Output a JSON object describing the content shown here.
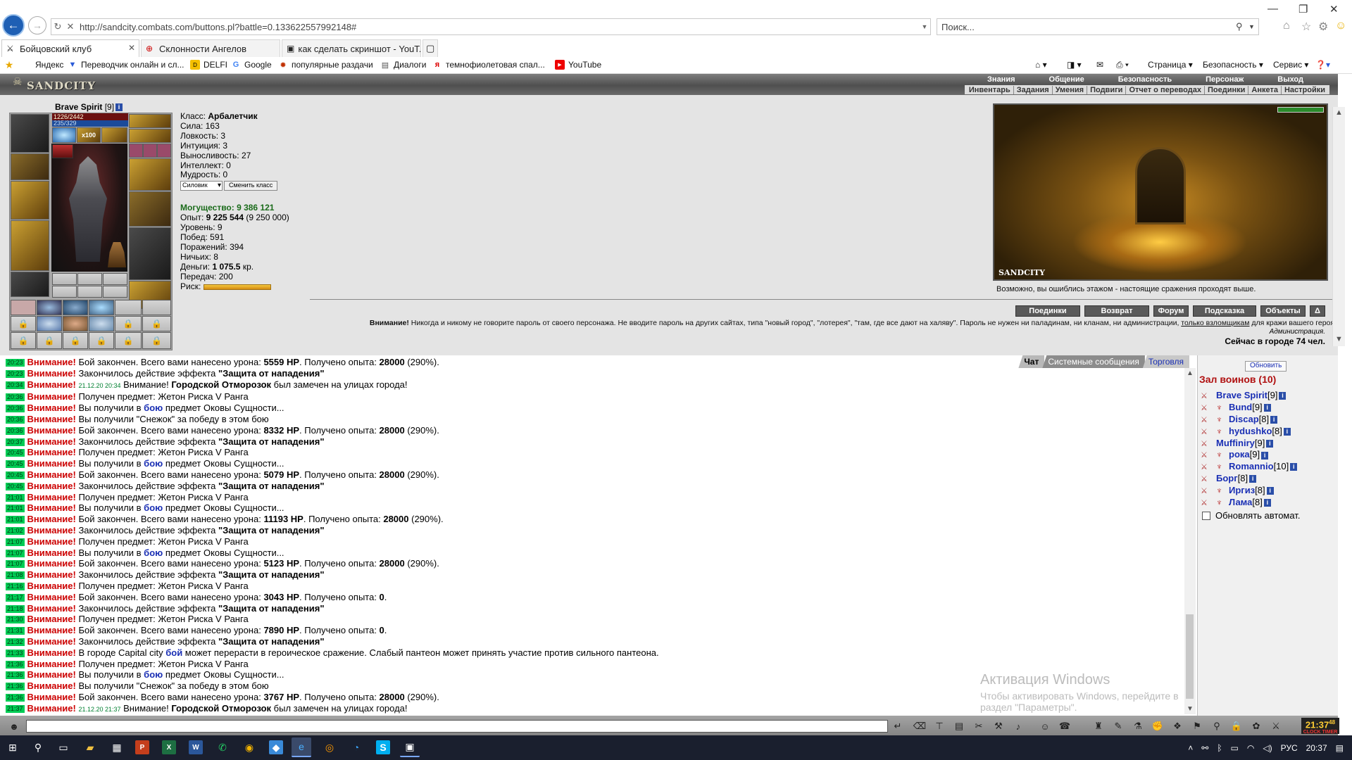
{
  "browser": {
    "url": "http://sandcity.combats.com/buttons.pl?battle=0.133622557992148#",
    "search_placeholder": "Поиск...",
    "tabs": [
      {
        "label": "Бойцовский клуб",
        "active": true
      },
      {
        "label": "Склонности Ангелов",
        "active": false
      },
      {
        "label": "как сделать скриншот - YouT...",
        "active": false
      }
    ],
    "favorites": [
      "Яндекс",
      "Переводчик онлайн и сл...",
      "DELFI",
      "Google",
      "популярные раздачи",
      "Диалоги",
      "темнофиолетовая спал...",
      "YouTube"
    ],
    "commands": {
      "page": "Страница",
      "safety": "Безопасность",
      "service": "Сервис"
    }
  },
  "game": {
    "logo": "SANDCITY",
    "menu_top": [
      "Знания",
      "Общение",
      "Безопасность",
      "Персонаж",
      "Выход"
    ],
    "menu_sub": [
      "Инвентарь",
      "Задания",
      "Умения",
      "Подвиги",
      "Отчет о переводах",
      "Поединки",
      "Анкета",
      "Настройки"
    ]
  },
  "character": {
    "name": "Brave Spirit",
    "level": "[9]",
    "hp": "1226/2442",
    "mp": "235/329",
    "rune_count": "x100",
    "class_label": "Класс:",
    "class_value": "Арбалетчик",
    "stats": [
      {
        "label": "Сила:",
        "value": "163"
      },
      {
        "label": "Ловкость:",
        "value": "3"
      },
      {
        "label": "Интуиция:",
        "value": "3"
      },
      {
        "label": "Выносливость:",
        "value": "27"
      },
      {
        "label": "Интеллект:",
        "value": "0"
      },
      {
        "label": "Мудрость:",
        "value": "0"
      }
    ],
    "class_select": "Силовик",
    "change_class_btn": "Сменить класс",
    "power_label": "Могущество:",
    "power_value": "9 386 121",
    "exp_label": "Опыт:",
    "exp_value": "9 225 544",
    "exp_next": "(9 250 000)",
    "level_label": "Уровень:",
    "level_value": "9",
    "wins_label": "Побед:",
    "wins_value": "591",
    "losses_label": "Поражений:",
    "losses_value": "394",
    "draws_label": "Ничьих:",
    "draws_value": "8",
    "money_label": "Деньги:",
    "money_value": "1 075.5",
    "money_unit": "кр.",
    "transfers_label": "Передач:",
    "transfers_value": "200",
    "risk_label": "Риск:",
    "risk_fraction": 1.0
  },
  "location": {
    "caption": "SANDCITY",
    "note": "Возможно, вы ошиблись этажом - настоящие сражения проходят выше.",
    "buttons": [
      "Поединки",
      "Возврат",
      "Форум",
      "Подсказка",
      "Объекты",
      "Δ"
    ]
  },
  "warning": {
    "bold": "Внимание!",
    "text": " Никогда и никому не говорите пароль от своего персонажа. Не вводите пароль на других сайтах, типа \"новый город\", \"лотерея\", \"там, где все дают на халяву\". Пароль не нужен ни паладинам, ни кланам, ни администрации, ",
    "link": "только взломщикам",
    "tail": " для кражи вашего героя.",
    "sign": "Администрация.",
    "online": "Сейчас в городе 74 чел."
  },
  "chat": {
    "tabs": [
      "Чат",
      "Системные сообщения",
      "Торговля"
    ],
    "messages": [
      {
        "time": "20:23",
        "parts": [
          [
            "n",
            "Бой закончен. Всего вами нанесено урона: "
          ],
          [
            "b",
            "5559 HP"
          ],
          [
            "n",
            ". Получено опыта: "
          ],
          [
            "b",
            "28000"
          ],
          [
            "n",
            " (290%)."
          ]
        ]
      },
      {
        "time": "20:23",
        "parts": [
          [
            "n",
            "Закончилось действие эффекта "
          ],
          [
            "b",
            "\"Защита от нападения\""
          ]
        ]
      },
      {
        "time": "20:34",
        "parts": [
          [
            "d",
            "21.12.20 20:34"
          ],
          [
            "n",
            " Внимание! "
          ],
          [
            "b",
            "Городской Отморозок"
          ],
          [
            "n",
            " был замечен на улицах города!"
          ]
        ]
      },
      {
        "time": "20:36",
        "parts": [
          [
            "n",
            "Получен предмет: Жетон Риска V Ранга"
          ]
        ]
      },
      {
        "time": "20:36",
        "parts": [
          [
            "n",
            "Вы получили в "
          ],
          [
            "l",
            "бою"
          ],
          [
            "n",
            " предмет Оковы Сущности..."
          ]
        ]
      },
      {
        "time": "20:36",
        "parts": [
          [
            "n",
            "Вы получили \"Снежок\" за победу в этом бою"
          ]
        ]
      },
      {
        "time": "20:36",
        "parts": [
          [
            "n",
            "Бой закончен. Всего вами нанесено урона: "
          ],
          [
            "b",
            "8332 HP"
          ],
          [
            "n",
            ". Получено опыта: "
          ],
          [
            "b",
            "28000"
          ],
          [
            "n",
            " (290%)."
          ]
        ]
      },
      {
        "time": "20:37",
        "parts": [
          [
            "n",
            "Закончилось действие эффекта "
          ],
          [
            "b",
            "\"Защита от нападения\""
          ]
        ]
      },
      {
        "time": "20:45",
        "parts": [
          [
            "n",
            "Получен предмет: Жетон Риска V Ранга"
          ]
        ]
      },
      {
        "time": "20:45",
        "parts": [
          [
            "n",
            "Вы получили в "
          ],
          [
            "l",
            "бою"
          ],
          [
            "n",
            " предмет Оковы Сущности..."
          ]
        ]
      },
      {
        "time": "20:45",
        "parts": [
          [
            "n",
            "Бой закончен. Всего вами нанесено урона: "
          ],
          [
            "b",
            "5079 HP"
          ],
          [
            "n",
            ". Получено опыта: "
          ],
          [
            "b",
            "28000"
          ],
          [
            "n",
            " (290%)."
          ]
        ]
      },
      {
        "time": "20:45",
        "parts": [
          [
            "n",
            "Закончилось действие эффекта "
          ],
          [
            "b",
            "\"Защита от нападения\""
          ]
        ]
      },
      {
        "time": "21:01",
        "parts": [
          [
            "n",
            "Получен предмет: Жетон Риска V Ранга"
          ]
        ]
      },
      {
        "time": "21:01",
        "parts": [
          [
            "n",
            "Вы получили в "
          ],
          [
            "l",
            "бою"
          ],
          [
            "n",
            " предмет Оковы Сущности..."
          ]
        ]
      },
      {
        "time": "21:01",
        "parts": [
          [
            "n",
            "Бой закончен. Всего вами нанесено урона: "
          ],
          [
            "b",
            "11193 HP"
          ],
          [
            "n",
            ". Получено опыта: "
          ],
          [
            "b",
            "28000"
          ],
          [
            "n",
            " (290%)."
          ]
        ]
      },
      {
        "time": "21:02",
        "parts": [
          [
            "n",
            "Закончилось действие эффекта "
          ],
          [
            "b",
            "\"Защита от нападения\""
          ]
        ]
      },
      {
        "time": "21:07",
        "parts": [
          [
            "n",
            "Получен предмет: Жетон Риска V Ранга"
          ]
        ]
      },
      {
        "time": "21:07",
        "parts": [
          [
            "n",
            "Вы получили в "
          ],
          [
            "l",
            "бою"
          ],
          [
            "n",
            " предмет Оковы Сущности..."
          ]
        ]
      },
      {
        "time": "21:07",
        "parts": [
          [
            "n",
            "Бой закончен. Всего вами нанесено урона: "
          ],
          [
            "b",
            "5123 HP"
          ],
          [
            "n",
            ". Получено опыта: "
          ],
          [
            "b",
            "28000"
          ],
          [
            "n",
            " (290%)."
          ]
        ]
      },
      {
        "time": "21:08",
        "parts": [
          [
            "n",
            "Закончилось действие эффекта "
          ],
          [
            "b",
            "\"Защита от нападения\""
          ]
        ]
      },
      {
        "time": "21:16",
        "parts": [
          [
            "n",
            "Получен предмет: Жетон Риска V Ранга"
          ]
        ]
      },
      {
        "time": "21:17",
        "parts": [
          [
            "n",
            "Бой закончен. Всего вами нанесено урона: "
          ],
          [
            "b",
            "3043 HP"
          ],
          [
            "n",
            ". Получено опыта: "
          ],
          [
            "b",
            "0"
          ],
          [
            "n",
            "."
          ]
        ]
      },
      {
        "time": "21:18",
        "parts": [
          [
            "n",
            "Закончилось действие эффекта "
          ],
          [
            "b",
            "\"Защита от нападения\""
          ]
        ]
      },
      {
        "time": "21:30",
        "parts": [
          [
            "n",
            "Получен предмет: Жетон Риска V Ранга"
          ]
        ]
      },
      {
        "time": "21:31",
        "parts": [
          [
            "n",
            "Бой закончен. Всего вами нанесено урона: "
          ],
          [
            "b",
            "7890 HP"
          ],
          [
            "n",
            ". Получено опыта: "
          ],
          [
            "b",
            "0"
          ],
          [
            "n",
            "."
          ]
        ]
      },
      {
        "time": "21:32",
        "parts": [
          [
            "n",
            "Закончилось действие эффекта "
          ],
          [
            "b",
            "\"Защита от нападения\""
          ]
        ]
      },
      {
        "time": "21:33",
        "parts": [
          [
            "n",
            "В городе Capital city "
          ],
          [
            "l",
            "бой"
          ],
          [
            "n",
            " может перерасти в героическое сражение. Слабый пантеон может принять участие против сильного пантеона."
          ]
        ]
      },
      {
        "time": "21:36",
        "parts": [
          [
            "n",
            "Получен предмет: Жетон Риска V Ранга"
          ]
        ]
      },
      {
        "time": "21:36",
        "parts": [
          [
            "n",
            "Вы получили в "
          ],
          [
            "l",
            "бою"
          ],
          [
            "n",
            " предмет Оковы Сущности..."
          ]
        ]
      },
      {
        "time": "21:36",
        "parts": [
          [
            "n",
            "Вы получили \"Снежок\" за победу в этом бою"
          ]
        ]
      },
      {
        "time": "21:36",
        "parts": [
          [
            "n",
            "Бой закончен. Всего вами нанесено урона: "
          ],
          [
            "b",
            "3767 HP"
          ],
          [
            "n",
            ". Получено опыта: "
          ],
          [
            "b",
            "28000"
          ],
          [
            "n",
            " (290%)."
          ]
        ]
      },
      {
        "time": "21:37",
        "parts": [
          [
            "d",
            "21.12.20 21:37"
          ],
          [
            "n",
            " Внимание! "
          ],
          [
            "b",
            "Городской Отморозок"
          ],
          [
            "n",
            " был замечен на улицах города!"
          ]
        ]
      }
    ],
    "warn_word": "Внимание!"
  },
  "windows_activation": {
    "title": "Активация Windows",
    "subtitle": "Чтобы активировать Windows, перейдите в раздел \"Параметры\"."
  },
  "room": {
    "refresh_btn": "Обновить",
    "title": "Зал воинов (10)",
    "players": [
      {
        "nick": "Brave Spirit",
        "level": "[9]",
        "clan": false
      },
      {
        "nick": "Bund",
        "level": "[9]",
        "clan": true
      },
      {
        "nick": "Discap",
        "level": "[8]",
        "clan": true
      },
      {
        "nick": "hydushko",
        "level": "[8]",
        "clan": true
      },
      {
        "nick": "Muffiniry",
        "level": "[9]",
        "clan": false
      },
      {
        "nick": "рока",
        "level": "[9]",
        "clan": true
      },
      {
        "nick": "Romannio",
        "level": "[10]",
        "clan": true
      },
      {
        "nick": "Борг",
        "level": "[8]",
        "clan": false
      },
      {
        "nick": "Иргиз",
        "level": "[8]",
        "clan": true
      },
      {
        "nick": "Лама",
        "level": "[8]",
        "clan": true
      }
    ],
    "auto_refresh": "Обновлять автомат."
  },
  "clock": {
    "time": "21:37",
    "seconds": "48",
    "label": "CLOCK TIMER"
  },
  "taskbar": {
    "lang": "РУС",
    "time": "20:37"
  },
  "colors": {
    "warn": "#cc0000",
    "link": "#1a2fb4",
    "timestamp_bg": "#00cc55",
    "power": "#1a6b1a"
  }
}
